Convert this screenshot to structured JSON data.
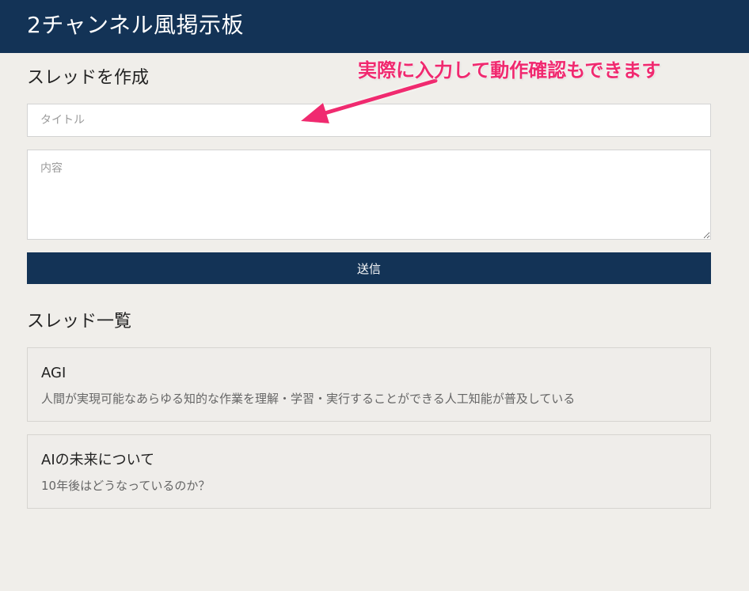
{
  "header": {
    "title": "2チャンネル風掲示板"
  },
  "create_section": {
    "title": "スレッドを作成",
    "title_input": {
      "placeholder": "タイトル",
      "value": ""
    },
    "content_input": {
      "placeholder": "内容",
      "value": ""
    },
    "submit_label": "送信"
  },
  "list_section": {
    "title": "スレッド一覧",
    "threads": [
      {
        "title": "AGI",
        "body": "人間が実現可能なあらゆる知的な作業を理解・学習・実行することができる人工知能が普及している"
      },
      {
        "title": "AIの未来について",
        "body": "10年後はどうなっているのか？"
      }
    ]
  },
  "annotation": {
    "text": "実際に入力して動作確認もできます",
    "color": "#f0296f"
  },
  "colors": {
    "header_bg": "#133356",
    "page_bg": "#f0eeea",
    "button_bg": "#133356"
  }
}
